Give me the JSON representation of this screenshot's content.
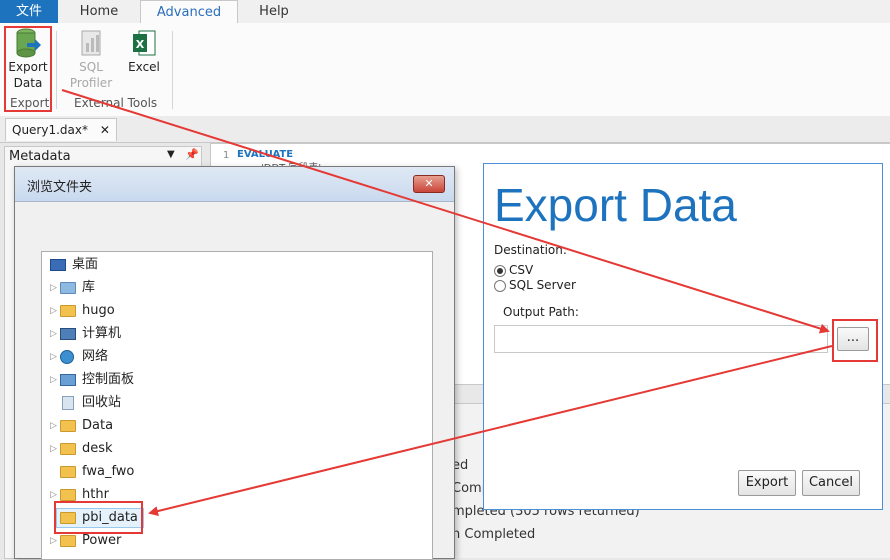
{
  "ribbon_tabs": [
    "文件",
    "Home",
    "Advanced",
    "Help"
  ],
  "ribbon": {
    "export_data": [
      "Export",
      "Data"
    ],
    "sql_profiler": [
      "SQL",
      "Profiler"
    ],
    "excel": "Excel",
    "group_export": "Export",
    "group_external": "External Tools"
  },
  "doc_tab": {
    "label": "Query1.dax*",
    "close": "✕"
  },
  "metadata": {
    "label": "Metadata"
  },
  "editor": {
    "line_no": "1",
    "keyword": "EVALUATE",
    "line2": "'DDT 字段表'"
  },
  "output_lines": [
    "ed",
    "Comp",
    "mpleted (305 rows returned)",
    "n Completed"
  ],
  "browse_dialog": {
    "title": "浏览文件夹",
    "close": "✕",
    "items": [
      "桌面",
      "库",
      "hugo",
      "计算机",
      "网络",
      "控制面板",
      "回收站",
      "Data",
      "desk",
      "fwa_fwo",
      "hthr",
      "pbi_data",
      "Power"
    ]
  },
  "export_panel": {
    "title": "Export Data",
    "destination_label": "Destination:",
    "options": [
      "CSV",
      "SQL Server"
    ],
    "output_path_label": "Output Path:",
    "output_path_value": "",
    "browse_button": "...",
    "export_button": "Export",
    "cancel_button": "Cancel"
  },
  "colors": {
    "accent": "#1e73be",
    "highlight": "#e53935"
  }
}
